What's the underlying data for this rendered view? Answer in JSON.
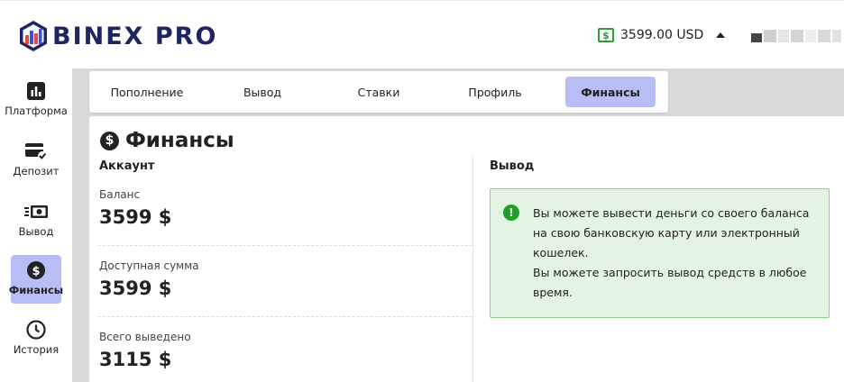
{
  "header": {
    "brand": "BINEX PRO",
    "balance": "3599.00 USD",
    "currency_icon": "dollar-box-icon",
    "colors": {
      "brand": "#1f2560",
      "green": "#2e9c3a"
    }
  },
  "sidebar": {
    "items": [
      {
        "label": "Платформа",
        "icon": "chart-icon"
      },
      {
        "label": "Депозит",
        "icon": "card-check-icon"
      },
      {
        "label": "Вывод",
        "icon": "cash-out-icon"
      },
      {
        "label": "Финансы",
        "icon": "dollar-coin-icon",
        "active": true
      },
      {
        "label": "История",
        "icon": "clock-icon"
      }
    ],
    "active_color": "#b8bdf5"
  },
  "tabs": [
    {
      "label": "Пополнение"
    },
    {
      "label": "Вывод"
    },
    {
      "label": "Ставки"
    },
    {
      "label": "Профиль"
    },
    {
      "label": "Финансы",
      "active": true
    }
  ],
  "page": {
    "title": "Финансы",
    "account": {
      "heading": "Аккаунт",
      "stats": [
        {
          "label": "Баланс",
          "value": "3599 $"
        },
        {
          "label": "Доступная сумма",
          "value": "3599 $"
        },
        {
          "label": "Всего выведено",
          "value": "3115 $"
        }
      ]
    },
    "withdraw": {
      "heading": "Вывод",
      "message_line1": "Вы можете вывести деньги со своего баланса на свою банковскую карту или электронный кошелек.",
      "message_line2": "Вы можете запросить вывод средств в любое время."
    }
  }
}
